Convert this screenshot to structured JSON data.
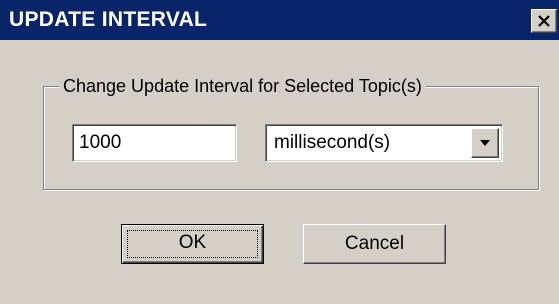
{
  "window": {
    "title": "UPDATE INTERVAL",
    "close_icon": "close-icon"
  },
  "group": {
    "label": "Change Update Interval for Selected Topic(s)"
  },
  "interval_input": {
    "value": "1000"
  },
  "unit_select": {
    "selected": "millisecond(s)",
    "arrow_icon": "chevron-down-icon"
  },
  "buttons": {
    "ok_label": "OK",
    "cancel_label": "Cancel"
  },
  "colors": {
    "titlebar": "#0a246a",
    "face": "#d4d0c8"
  }
}
